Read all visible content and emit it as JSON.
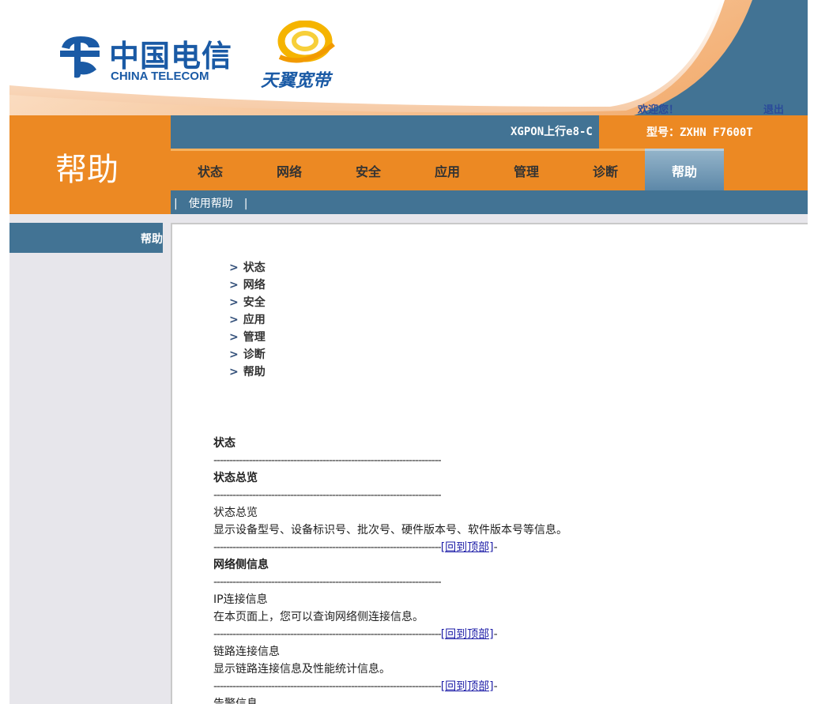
{
  "header": {
    "logo_cn": "中国电信",
    "logo_en": "CHINA TELECOM",
    "brand": "天翼宽带",
    "welcome": "欢迎您！",
    "logout": "退出"
  },
  "page_title": "帮助",
  "device": {
    "name": "XGPON上行e8-C",
    "model": "型号：ZXHN F7600T"
  },
  "tabs": [
    {
      "label": "状态"
    },
    {
      "label": "网络"
    },
    {
      "label": "安全"
    },
    {
      "label": "应用"
    },
    {
      "label": "管理"
    },
    {
      "label": "诊断"
    },
    {
      "label": "帮助",
      "active": true
    }
  ],
  "subnav": {
    "item": "使用帮助",
    "separator": "|"
  },
  "sidebar": {
    "item": "帮助"
  },
  "toc": {
    "arrow": ">",
    "items": [
      "状态",
      "网络",
      "安全",
      "应用",
      "管理",
      "诊断",
      "帮助"
    ]
  },
  "doc": {
    "rule": "-----------------------------------------------------------------------",
    "back_link": "[回到顶部]",
    "back_tail": "-",
    "section1": "状态",
    "sub1": "状态总览",
    "item1_title": "状态总览",
    "item1_desc": "显示设备型号、设备标识号、批次号、硬件版本号、软件版本号等信息。",
    "sub2": "网络侧信息",
    "item2_title": "IP连接信息",
    "item2_desc": "在本页面上，您可以查询网络侧连接信息。",
    "item3_title": "链路连接信息",
    "item3_desc": "显示链路连接信息及性能统计信息。",
    "item4_title": "告警信息"
  },
  "colors": {
    "orange": "#ec8923",
    "steel_blue": "#427394",
    "brand_blue": "#1a5aa5",
    "link": "#1f1fa8"
  }
}
